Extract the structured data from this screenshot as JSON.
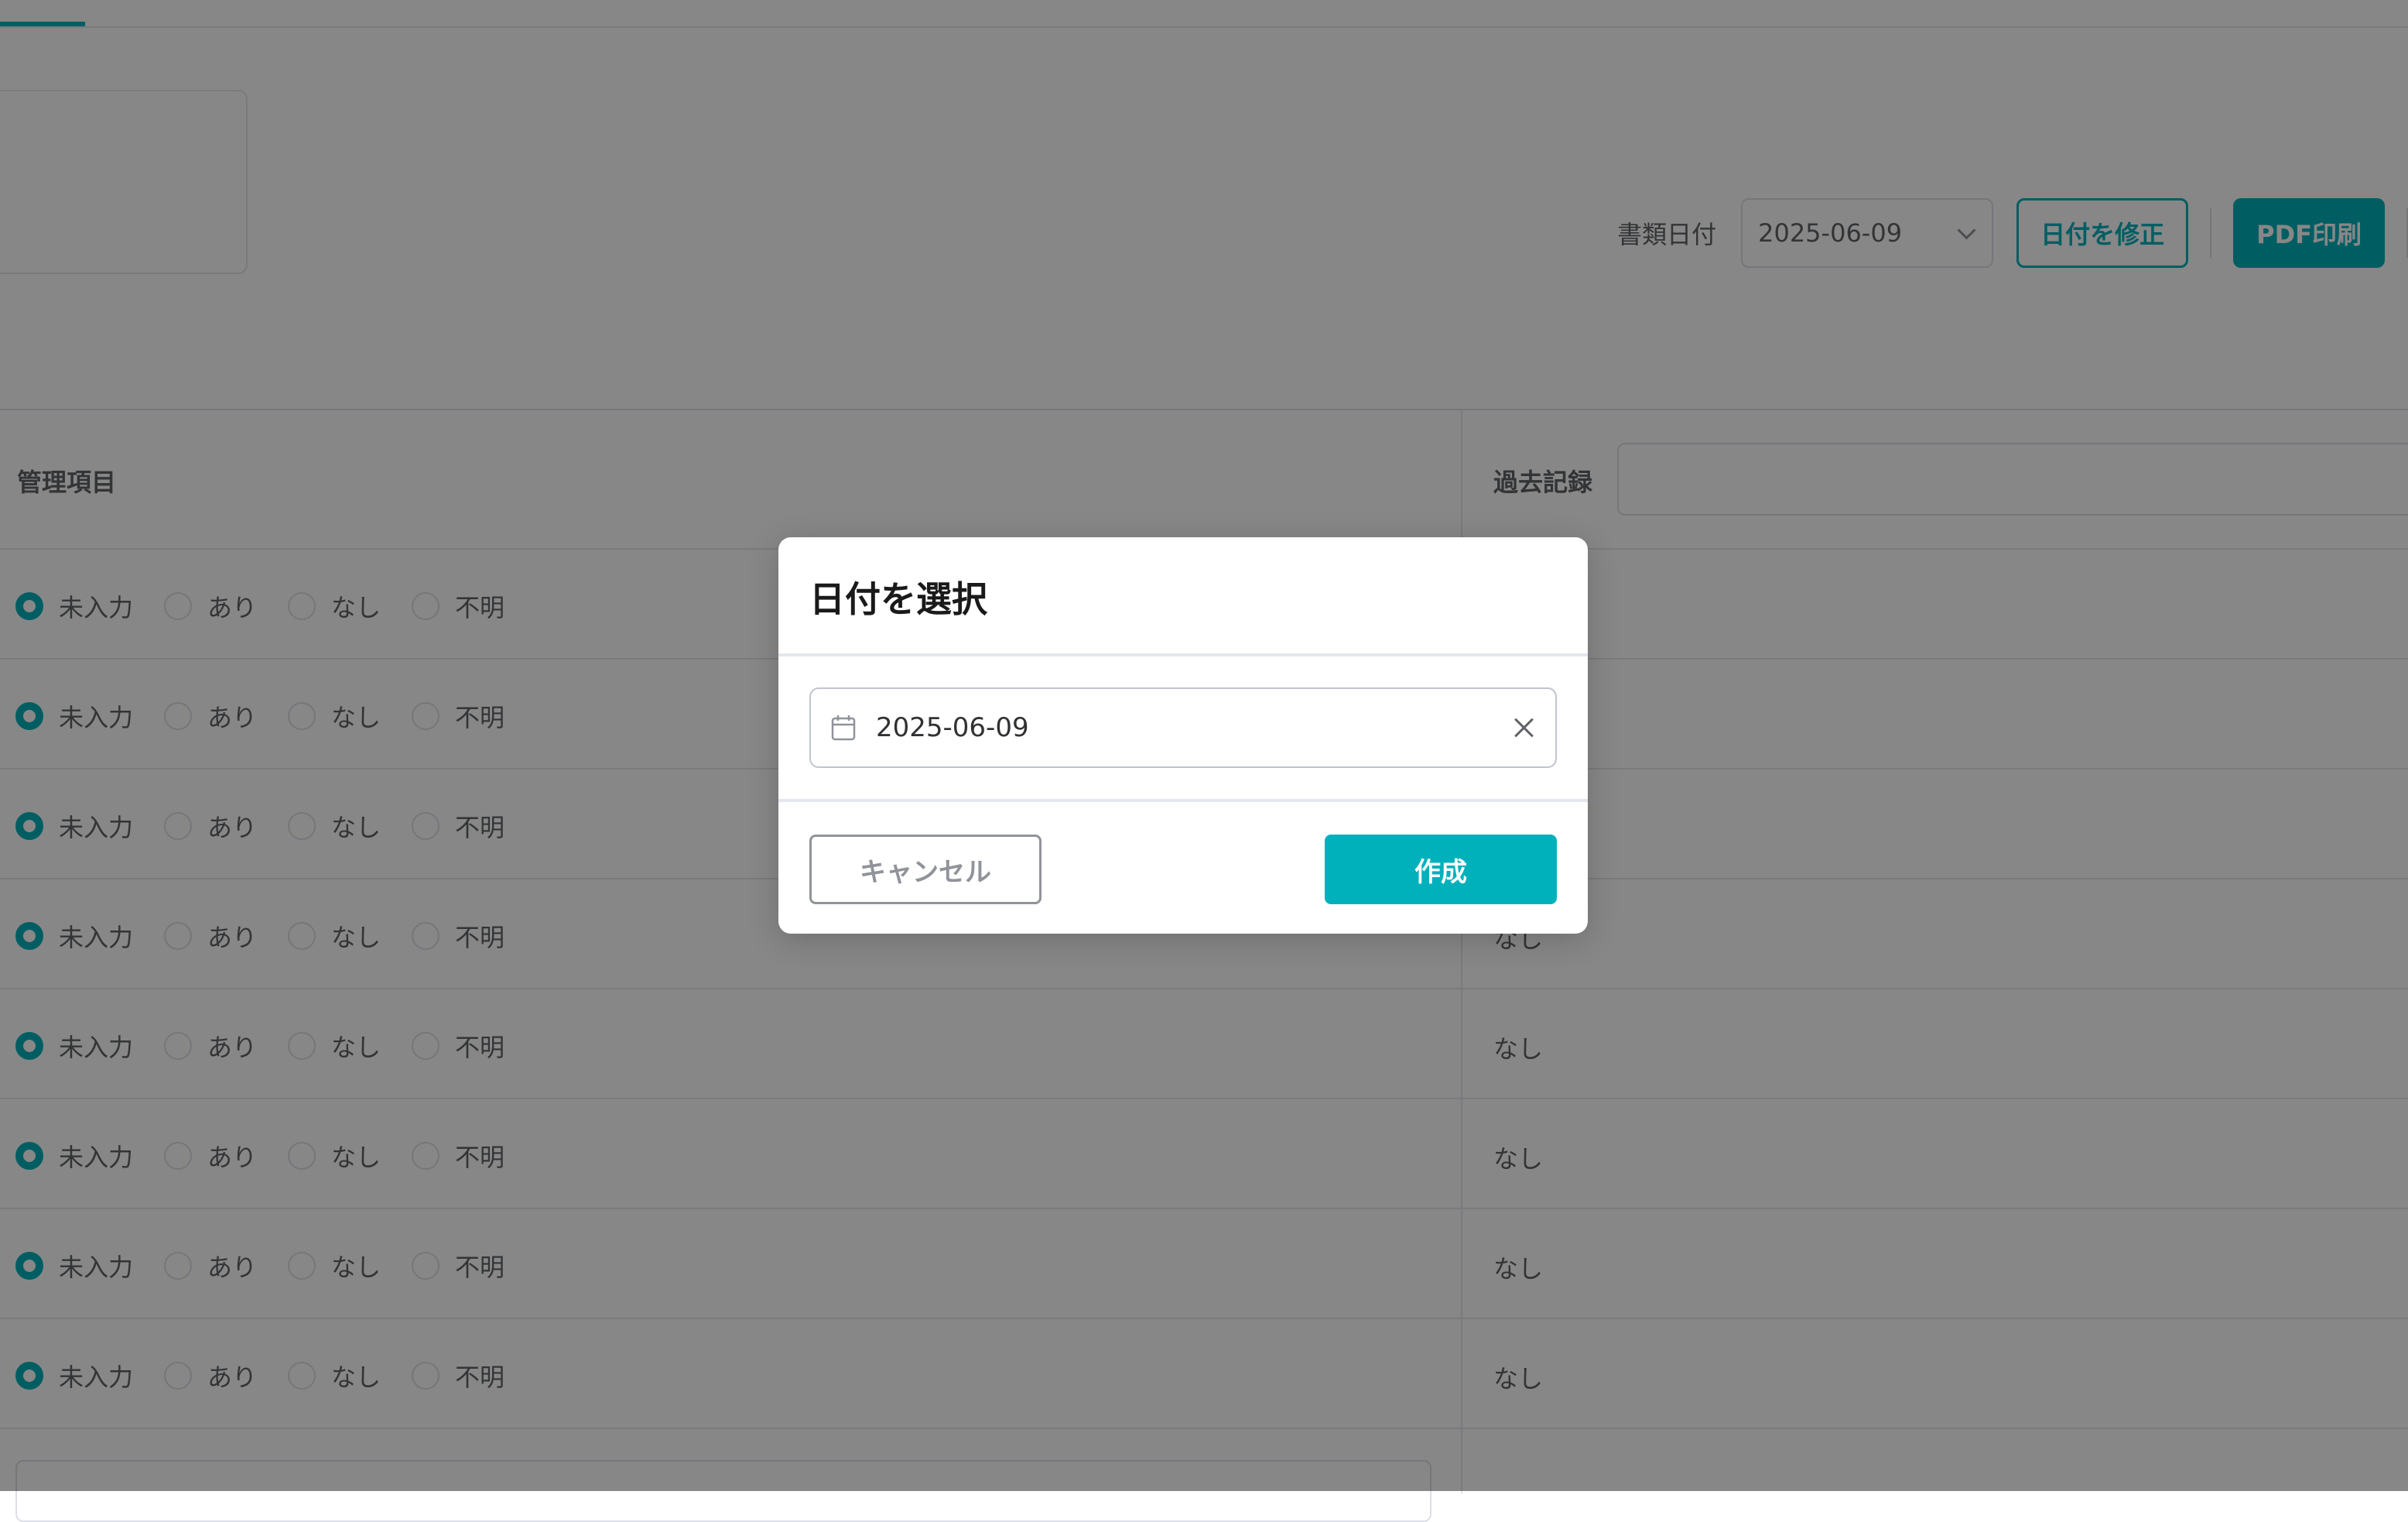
{
  "toolbar": {
    "document_date_label": "書類日付",
    "document_date_value": "2025-06-09",
    "edit_date_label": "日付を修正",
    "pdf_print_label": "PDF印刷"
  },
  "table": {
    "header_left": "管理項目",
    "header_right": "過去記録",
    "radio_options": [
      "未入力",
      "あり",
      "なし",
      "不明"
    ],
    "selected_option": "未入力",
    "history_values": [
      "",
      "",
      "",
      "なし",
      "なし",
      "なし",
      "なし",
      "なし"
    ]
  },
  "dialog": {
    "title": "日付を選択",
    "date_value": "2025-06-09",
    "cancel_label": "キャンセル",
    "create_label": "作成"
  },
  "colors": {
    "accent": "#00b1bc",
    "overlay": "rgba(0,0,0,0.47)"
  },
  "icons": [
    "calendar-icon",
    "clear-icon",
    "chevron-down-icon"
  ]
}
